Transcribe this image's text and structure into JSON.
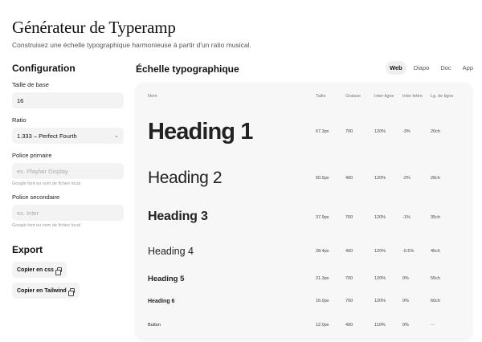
{
  "header": {
    "title": "Générateur de Typeramp",
    "subtitle": "Construisez une échelle typographique harmonieuse à partir d'un ratio musical."
  },
  "config": {
    "heading": "Configuration",
    "base_size_label": "Taille de base",
    "base_size_value": "16",
    "ratio_label": "Ratio",
    "ratio_value": "1.333 – Perfect Fourth",
    "primary_font_label": "Police primaire",
    "primary_font_placeholder": "ex. Playfair Display",
    "primary_font_hint": "Google font ou nom de fichier local",
    "secondary_font_label": "Police secondaire",
    "secondary_font_placeholder": "ex. Inter",
    "secondary_font_hint": "Google font ou nom de fichier local"
  },
  "export": {
    "heading": "Export",
    "copy_css": "Copier en css",
    "copy_tailwind": "Copier en Tailwind"
  },
  "scale": {
    "heading": "Échelle typographique",
    "tabs": [
      {
        "label": "Web",
        "active": true
      },
      {
        "label": "Diapo",
        "active": false
      },
      {
        "label": "Doc",
        "active": false
      },
      {
        "label": "App",
        "active": false
      }
    ],
    "columns": {
      "name": "Nom",
      "size": "Taille",
      "weight": "Graisse",
      "line_height": "Inter-ligne",
      "letter_spacing": "Inter-lettre",
      "line_length": "Lg. de ligne"
    },
    "rows": [
      {
        "name": "Heading 1",
        "size": "67.3px",
        "weight": "700",
        "line_height": "120%",
        "letter_spacing": "-3%",
        "line_length": "20ch"
      },
      {
        "name": "Heading 2",
        "size": "50.5px",
        "weight": "400",
        "line_height": "120%",
        "letter_spacing": "-2%",
        "line_length": "28ch"
      },
      {
        "name": "Heading 3",
        "size": "37.9px",
        "weight": "700",
        "line_height": "120%",
        "letter_spacing": "-1%",
        "line_length": "35ch"
      },
      {
        "name": "Heading 4",
        "size": "28.4px",
        "weight": "400",
        "line_height": "120%",
        "letter_spacing": "-0.5%",
        "line_length": "45ch"
      },
      {
        "name": "Heading 5",
        "size": "21.3px",
        "weight": "700",
        "line_height": "120%",
        "letter_spacing": "0%",
        "line_length": "55ch"
      },
      {
        "name": "Heading 6",
        "size": "16.0px",
        "weight": "700",
        "line_height": "120%",
        "letter_spacing": "0%",
        "line_length": "60ch"
      },
      {
        "name": "Button",
        "size": "12.0px",
        "weight": "400",
        "line_height": "110%",
        "letter_spacing": "0%",
        "line_length": "—"
      }
    ]
  }
}
